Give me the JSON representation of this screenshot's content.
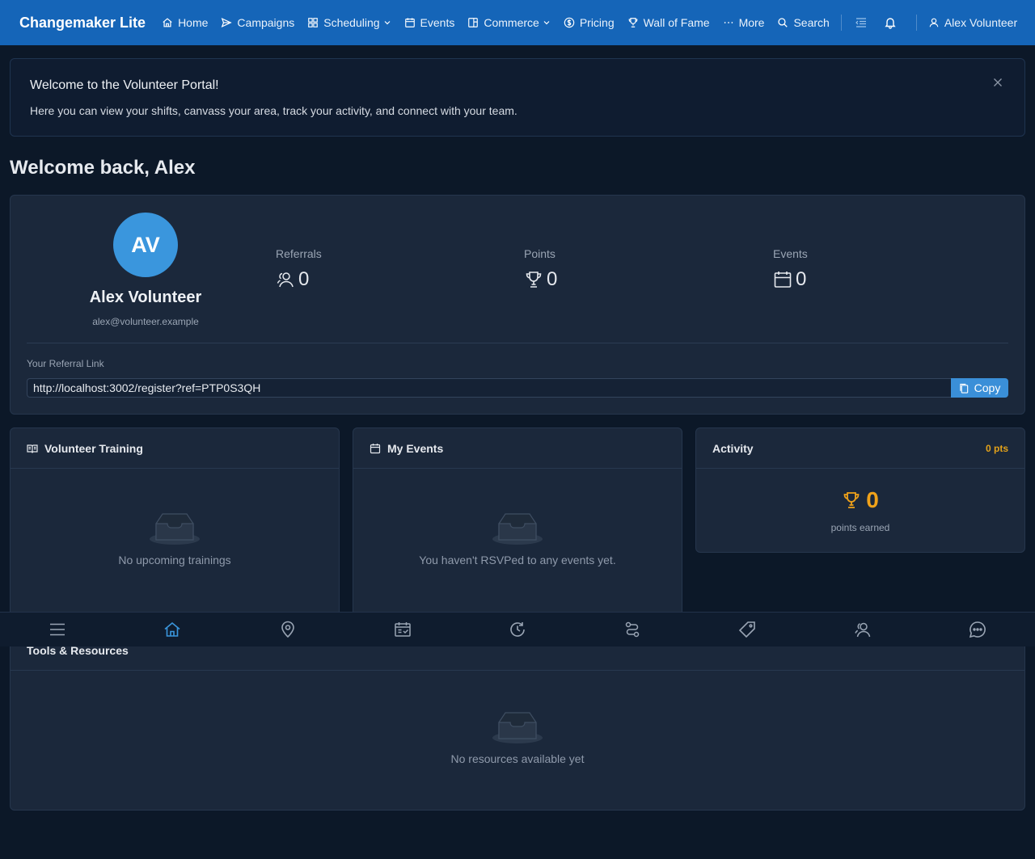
{
  "nav": {
    "brand": "Changemaker Lite",
    "items": [
      {
        "label": "Home",
        "icon": "home-icon"
      },
      {
        "label": "Campaigns",
        "icon": "send-icon"
      },
      {
        "label": "Scheduling",
        "icon": "grid-icon",
        "dropdown": true
      },
      {
        "label": "Events",
        "icon": "calendar-icon"
      },
      {
        "label": "Commerce",
        "icon": "shop-icon",
        "dropdown": true
      },
      {
        "label": "Pricing",
        "icon": "dollar-icon"
      },
      {
        "label": "Wall of Fame",
        "icon": "trophy-icon"
      },
      {
        "label": "More",
        "icon": "ellipsis-icon"
      },
      {
        "label": "Search",
        "icon": "search-icon"
      }
    ],
    "user": "Alex Volunteer"
  },
  "banner": {
    "title": "Welcome to the Volunteer Portal!",
    "text": "Here you can view your shifts, canvass your area, track your activity, and connect with your team."
  },
  "heading": "Welcome back, Alex",
  "profile": {
    "initials": "AV",
    "name": "Alex Volunteer",
    "email": "alex@volunteer.example",
    "stats": [
      {
        "label": "Referrals",
        "value": "0",
        "icon": "referrals-icon"
      },
      {
        "label": "Points",
        "value": "0",
        "icon": "trophy-icon"
      },
      {
        "label": "Events",
        "value": "0",
        "icon": "calendar-icon"
      }
    ],
    "referral_label": "Your Referral Link",
    "referral_link": "http://localhost:3002/register?ref=PTP0S3QH",
    "copy_label": "Copy"
  },
  "training": {
    "title": "Volunteer Training",
    "empty": "No upcoming trainings"
  },
  "events": {
    "title": "My Events",
    "empty": "You haven't RSVPed to any events yet."
  },
  "activity": {
    "title": "Activity",
    "points_badge": "0 pts",
    "value": "0",
    "sub": "points earned"
  },
  "resources": {
    "title": "Tools & Resources",
    "empty": "No resources available yet"
  },
  "bottom_nav": [
    "menu-icon",
    "home-icon",
    "map-pin-icon",
    "schedule-icon",
    "history-icon",
    "route-icon",
    "tag-icon",
    "user-icon",
    "chat-icon"
  ],
  "colors": {
    "nav": "#1565b8",
    "accent": "#3a96dd",
    "points": "#f0a21a",
    "bg": "#0c1828"
  }
}
